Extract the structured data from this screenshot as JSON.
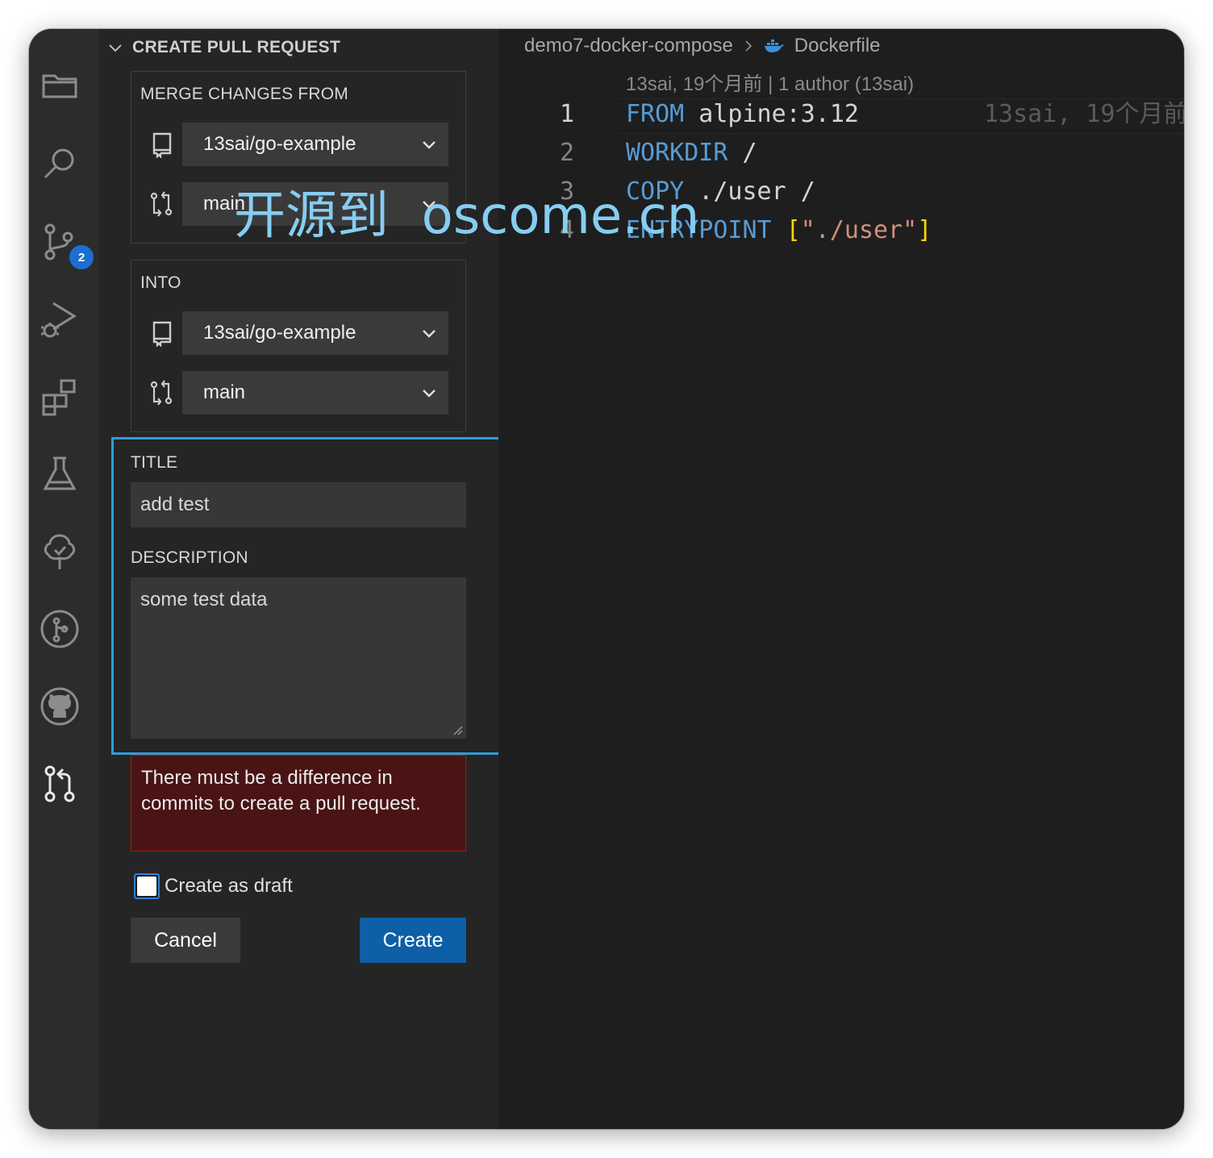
{
  "activity_bar": {
    "icons": [
      "explorer-icon",
      "search-icon",
      "source-control-icon",
      "run-debug-icon",
      "extensions-icon",
      "testing-icon",
      "tree-check-icon",
      "git-graph-icon",
      "github-icon",
      "pull-request-icon"
    ],
    "source_control_badge": "2"
  },
  "sidebar": {
    "header": "CREATE PULL REQUEST",
    "merge_from": {
      "label": "MERGE CHANGES FROM",
      "repo": "13sai/go-example",
      "branch": "main"
    },
    "into": {
      "label": "INTO",
      "repo": "13sai/go-example",
      "branch": "main"
    },
    "title_label": "TITLE",
    "title_value": "add test",
    "description_label": "DESCRIPTION",
    "description_value": "some test data",
    "error": "There must be a difference in commits to create a pull request.",
    "draft_label": "Create as draft",
    "draft_checked": false,
    "cancel_label": "Cancel",
    "create_label": "Create"
  },
  "editor": {
    "breadcrumb": [
      "demo7-docker-compose",
      "Dockerfile"
    ],
    "blame_header": "13sai, 19个月前 | 1 author (13sai)",
    "inline_blame": "13sai, 19个月前",
    "lines": [
      {
        "num": "1",
        "keyword": "FROM",
        "rest": " alpine:3.12"
      },
      {
        "num": "2",
        "keyword": "WORKDIR",
        "rest": " /"
      },
      {
        "num": "3",
        "keyword": "COPY",
        "rest": " ./user /"
      },
      {
        "num": "4",
        "keyword": "ENTRYPOINT",
        "rest": " ",
        "bracket_open": "[",
        "string": "\"./user\"",
        "bracket_close": "]"
      }
    ]
  },
  "watermark": "开源到  oscome.cn",
  "colors": {
    "accent_blue": "#2f9ed8",
    "button_primary": "#0e5fa6",
    "error_bg": "#4a1414",
    "error_border": "#be1100",
    "keyword": "#569cd6",
    "string": "#ce9178",
    "watermark": "#86cdf2"
  }
}
